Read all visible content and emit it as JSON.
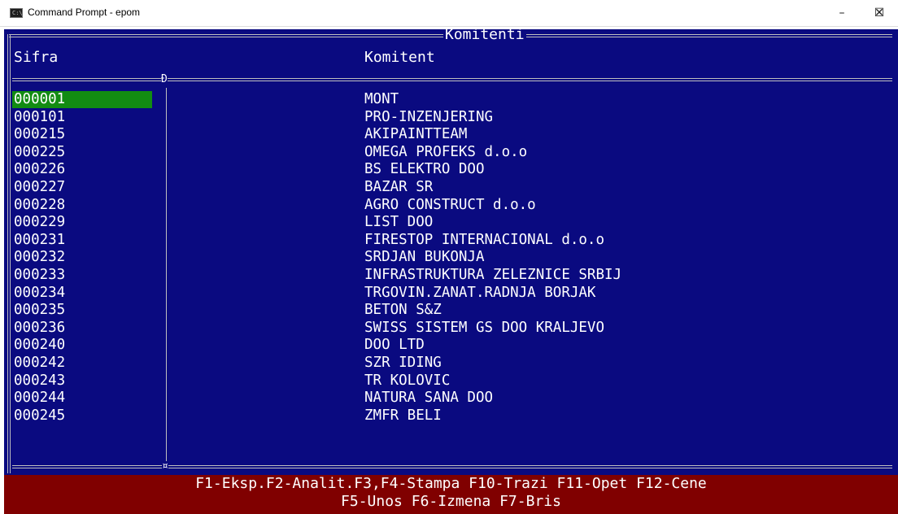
{
  "window": {
    "title": "Command Prompt - epom",
    "icon": "console-app-icon",
    "icon_text": "C:\\",
    "controls": {
      "minimize": "–",
      "maximize": "☐",
      "close": "✕"
    }
  },
  "frame": {
    "title": "Komitenti",
    "col_code_header": "Sifra",
    "col_name_header": "Komitent",
    "junction_top": "Đ",
    "junction_bottom": "¤"
  },
  "colors": {
    "console_bg": "#0a0a80",
    "selection_bg": "#128c12",
    "footer_bg": "#800000",
    "text": "#ffffff"
  },
  "rows": [
    {
      "code": "000001",
      "name": "MONT",
      "selected": true
    },
    {
      "code": "000101",
      "name": "PRO-INZENJERING"
    },
    {
      "code": "000215",
      "name": "AKIPAINTTEAM"
    },
    {
      "code": "000225",
      "name": "OMEGA PROFEKS d.o.o"
    },
    {
      "code": "000226",
      "name": "BS ELEKTRO DOO"
    },
    {
      "code": "000227",
      "name": "BAZAR SR"
    },
    {
      "code": "000228",
      "name": "AGRO CONSTRUCT d.o.o"
    },
    {
      "code": "000229",
      "name": "LIST DOO"
    },
    {
      "code": "000231",
      "name": "FIRESTOP INTERNACIONAL d.o.o"
    },
    {
      "code": "000232",
      "name": "SRDJAN BUKONJA"
    },
    {
      "code": "000233",
      "name": "INFRASTRUKTURA ZELEZNICE SRBIJ"
    },
    {
      "code": "000234",
      "name": "TRGOVIN.ZANAT.RADNJA BORJAK"
    },
    {
      "code": "000235",
      "name": "BETON S&Z"
    },
    {
      "code": "000236",
      "name": "SWISS SISTEM GS DOO KRALJEVO"
    },
    {
      "code": "000240",
      "name": "DOO LTD"
    },
    {
      "code": "000242",
      "name": "SZR IDING"
    },
    {
      "code": "000243",
      "name": "TR KOLOVIC"
    },
    {
      "code": "000244",
      "name": "NATURA SANA DOO"
    },
    {
      "code": "000245",
      "name": "ZMFR BELI"
    }
  ],
  "footer": {
    "line1": "F1-Eksp.F2-Analit.F3,F4-Stampa F10-Trazi F11-Opet F12-Cene",
    "line2": "F5-Unos F6-Izmena F7-Bris"
  }
}
